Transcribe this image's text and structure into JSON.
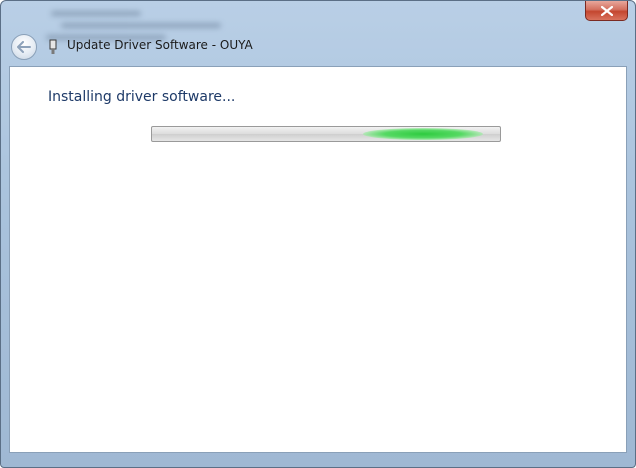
{
  "window": {
    "title": "Update Driver Software - OUYA"
  },
  "content": {
    "heading": "Installing driver software..."
  },
  "progress": {
    "mode": "marquee",
    "highlight_position": 0.78,
    "glow_color": "#2ecb3f"
  },
  "icons": {
    "close": "close-icon",
    "back": "back-arrow-icon",
    "device": "usb-device-icon"
  }
}
